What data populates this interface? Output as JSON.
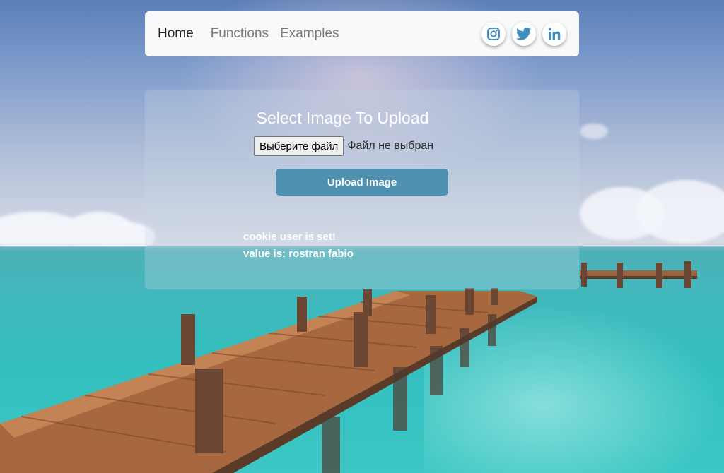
{
  "nav": {
    "links": [
      "Home",
      "Functions",
      "Examples"
    ],
    "social": [
      {
        "icon": "instagram-icon"
      },
      {
        "icon": "twitter-icon"
      },
      {
        "icon": "linkedin-icon"
      }
    ],
    "social_color": "#3d8fc0"
  },
  "upload": {
    "title": "Select Image To Upload",
    "file_button_label": "Выберите файл",
    "file_status": "Файл не выбран",
    "submit_label": "Upload Image",
    "button_color": "#4f8fb0"
  },
  "cookie": {
    "line1": "cookie user is set!",
    "line2": "value is: rostran fabio"
  }
}
